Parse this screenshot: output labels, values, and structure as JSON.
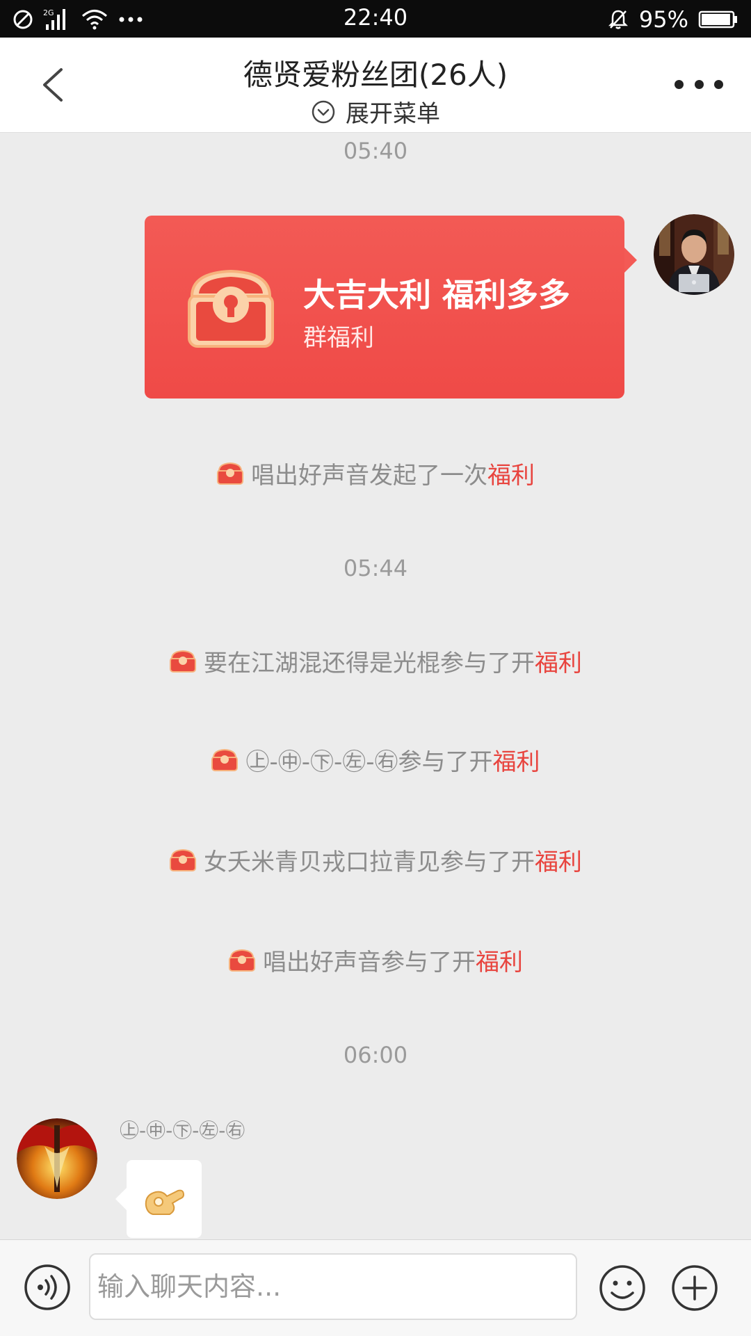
{
  "status_bar": {
    "time": "22:40",
    "network": "2G",
    "battery": "95%",
    "battery_level": 0.95,
    "icons": [
      "blocked-icon",
      "signal-icon",
      "wifi-icon",
      "more-notifications-icon",
      "muted-bell-icon",
      "battery-icon"
    ]
  },
  "header": {
    "title": "德贤爱粉丝团(26人)",
    "menu_toggle": "展开菜单"
  },
  "messages": {
    "ts1": "05:40",
    "welfare_card": {
      "title": "大吉大利 福利多多",
      "subtitle": "群福利"
    },
    "sys1": {
      "text": "唱出好声音发起了一次",
      "highlight": "福利"
    },
    "ts2": "05:44",
    "sys2": {
      "text": "要在江湖混还得是光棍参与了开",
      "highlight": "福利"
    },
    "sys3": {
      "text": "㊤-㊥-㊦-㊧-㊨参与了开",
      "highlight": "福利"
    },
    "sys4": {
      "text": "女夭米青贝戎口拉青见参与了开",
      "highlight": "福利"
    },
    "sys5": {
      "text": "唱出好声音参与了开",
      "highlight": "福利"
    },
    "ts3": "06:00",
    "last_sender": "㊤-㊥-㊦-㊧-㊨",
    "last_bubble_emoji": "👌"
  },
  "input": {
    "placeholder": "输入聊天内容..."
  },
  "colors": {
    "accent_red": "#ef4a47",
    "highlight_red": "#e8443e",
    "chat_bg": "#ececec"
  }
}
